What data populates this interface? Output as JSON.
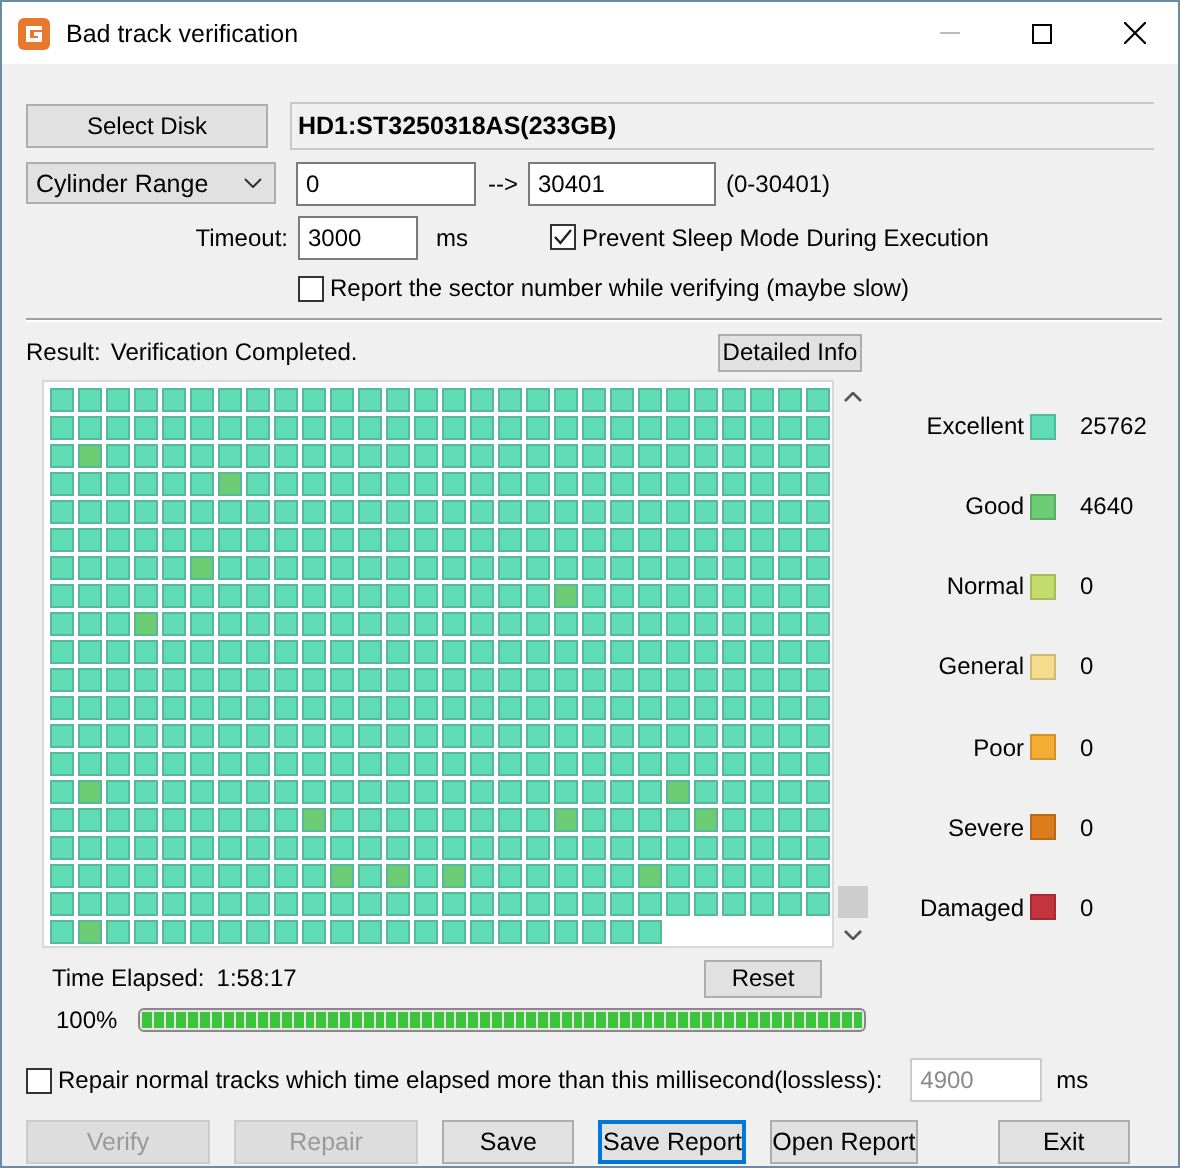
{
  "window": {
    "title": "Bad track verification"
  },
  "select_disk_button": "Select Disk",
  "disk_name": "HD1:ST3250318AS(233GB)",
  "range_mode": "Cylinder Range",
  "range_start": "0",
  "range_arrow": "-->",
  "range_end": "30401",
  "range_hint": "(0-30401)",
  "timeout": {
    "label": "Timeout:",
    "value": "3000",
    "unit": "ms"
  },
  "prevent_sleep": {
    "label": "Prevent Sleep Mode During Execution",
    "checked": true
  },
  "report_sector": {
    "label": "Report the sector number while verifying (maybe slow)",
    "checked": false
  },
  "result": {
    "label": "Result:",
    "value": "Verification Completed."
  },
  "detailed_info_button": "Detailed Info",
  "grid": {
    "good_cells": [
      [
        false,
        false,
        false,
        false,
        false,
        false,
        false,
        false,
        false,
        false,
        false,
        false,
        false,
        false,
        false,
        false,
        false,
        false,
        false,
        false,
        false,
        false,
        false,
        false,
        false,
        false,
        false,
        false
      ],
      [
        false,
        false,
        false,
        false,
        false,
        false,
        false,
        false,
        false,
        false,
        false,
        false,
        false,
        false,
        false,
        false,
        false,
        false,
        false,
        false,
        false,
        false,
        false,
        false,
        false,
        false,
        false,
        false
      ],
      [
        false,
        true,
        false,
        false,
        false,
        false,
        false,
        false,
        false,
        false,
        false,
        false,
        false,
        false,
        false,
        false,
        false,
        false,
        false,
        false,
        false,
        false,
        false,
        false,
        false,
        false,
        false,
        false
      ],
      [
        false,
        false,
        false,
        false,
        false,
        false,
        true,
        false,
        false,
        false,
        false,
        false,
        false,
        false,
        false,
        false,
        false,
        false,
        false,
        false,
        false,
        false,
        false,
        false,
        false,
        false,
        false,
        false
      ],
      [
        false,
        false,
        false,
        false,
        false,
        false,
        false,
        false,
        false,
        false,
        false,
        false,
        false,
        false,
        false,
        false,
        false,
        false,
        false,
        false,
        false,
        false,
        false,
        false,
        false,
        false,
        false,
        false
      ],
      [
        false,
        false,
        false,
        false,
        false,
        false,
        false,
        false,
        false,
        false,
        false,
        false,
        false,
        false,
        false,
        false,
        false,
        false,
        false,
        false,
        false,
        false,
        false,
        false,
        false,
        false,
        false,
        false
      ],
      [
        false,
        false,
        false,
        false,
        false,
        true,
        false,
        false,
        false,
        false,
        false,
        false,
        false,
        false,
        false,
        false,
        false,
        false,
        false,
        false,
        false,
        false,
        false,
        false,
        false,
        false,
        false,
        false
      ],
      [
        false,
        false,
        false,
        false,
        false,
        false,
        false,
        false,
        false,
        false,
        false,
        false,
        false,
        false,
        false,
        false,
        false,
        false,
        true,
        false,
        false,
        false,
        false,
        false,
        false,
        false,
        false,
        false
      ],
      [
        false,
        false,
        false,
        true,
        false,
        false,
        false,
        false,
        false,
        false,
        false,
        false,
        false,
        false,
        false,
        false,
        false,
        false,
        false,
        false,
        false,
        false,
        false,
        false,
        false,
        false,
        false,
        false
      ],
      [
        false,
        false,
        false,
        false,
        false,
        false,
        false,
        false,
        false,
        false,
        false,
        false,
        false,
        false,
        false,
        false,
        false,
        false,
        false,
        false,
        false,
        false,
        false,
        false,
        false,
        false,
        false,
        false
      ],
      [
        false,
        false,
        false,
        false,
        false,
        false,
        false,
        false,
        false,
        false,
        false,
        false,
        false,
        false,
        false,
        false,
        false,
        false,
        false,
        false,
        false,
        false,
        false,
        false,
        false,
        false,
        false,
        false
      ],
      [
        false,
        false,
        false,
        false,
        false,
        false,
        false,
        false,
        false,
        false,
        false,
        false,
        false,
        false,
        false,
        false,
        false,
        false,
        false,
        false,
        false,
        false,
        false,
        false,
        false,
        false,
        false,
        false
      ],
      [
        false,
        false,
        false,
        false,
        false,
        false,
        false,
        false,
        false,
        false,
        false,
        false,
        false,
        false,
        false,
        false,
        false,
        false,
        false,
        false,
        false,
        false,
        false,
        false,
        false,
        false,
        false,
        false
      ],
      [
        false,
        false,
        false,
        false,
        false,
        false,
        false,
        false,
        false,
        false,
        false,
        false,
        false,
        false,
        false,
        false,
        false,
        false,
        false,
        false,
        false,
        false,
        false,
        false,
        false,
        false,
        false,
        false
      ],
      [
        false,
        true,
        false,
        false,
        false,
        false,
        false,
        false,
        false,
        false,
        false,
        false,
        false,
        false,
        false,
        false,
        false,
        false,
        false,
        false,
        false,
        false,
        true,
        false,
        false,
        false,
        false,
        false
      ],
      [
        false,
        false,
        false,
        false,
        false,
        false,
        false,
        false,
        false,
        true,
        false,
        false,
        false,
        false,
        false,
        false,
        false,
        false,
        true,
        false,
        false,
        false,
        false,
        true,
        false,
        false,
        false,
        false
      ],
      [
        false,
        false,
        false,
        false,
        false,
        false,
        false,
        false,
        false,
        false,
        false,
        false,
        false,
        false,
        false,
        false,
        false,
        false,
        false,
        false,
        false,
        false,
        false,
        false,
        false,
        false,
        false,
        false
      ],
      [
        false,
        false,
        false,
        false,
        false,
        false,
        false,
        false,
        false,
        false,
        true,
        false,
        true,
        false,
        true,
        false,
        false,
        false,
        false,
        false,
        false,
        true,
        false,
        false,
        false,
        false,
        false,
        false
      ],
      [
        false,
        false,
        false,
        false,
        false,
        false,
        false,
        false,
        false,
        false,
        false,
        false,
        false,
        false,
        false,
        false,
        false,
        false,
        false,
        false,
        false,
        false,
        false,
        false,
        false,
        false,
        false,
        false
      ],
      [
        false,
        true,
        false,
        false,
        false,
        false,
        false,
        false,
        false,
        false,
        false,
        false,
        false,
        false,
        false,
        false,
        false,
        false,
        false,
        false,
        false,
        false
      ]
    ]
  },
  "legend": [
    {
      "label": "Excellent",
      "color": "#5fdcb4",
      "count": "25762"
    },
    {
      "label": "Good",
      "color": "#6ccc74",
      "count": "4640"
    },
    {
      "label": "Normal",
      "color": "#c4dc6c",
      "count": "0"
    },
    {
      "label": "General",
      "color": "#f4dc8c",
      "count": "0"
    },
    {
      "label": "Poor",
      "color": "#f4ac34",
      "count": "0"
    },
    {
      "label": "Severe",
      "color": "#dc7c1c",
      "count": "0"
    },
    {
      "label": "Damaged",
      "color": "#c4343c",
      "count": "0"
    }
  ],
  "time_elapsed": {
    "label": "Time Elapsed:",
    "value": "1:58:17"
  },
  "reset_button": "Reset",
  "progress": {
    "percent": "100%",
    "level": 1
  },
  "repair_option": {
    "label": "Repair normal tracks which time elapsed more than this millisecond(lossless):",
    "checked": false,
    "value": "4900",
    "disabled": true,
    "unit": "ms"
  },
  "buttons": [
    {
      "label": "Verify",
      "disabled": true,
      "default": false
    },
    {
      "label": "Repair",
      "disabled": true,
      "default": false
    },
    {
      "label": "Save",
      "disabled": false,
      "default": false
    },
    {
      "label": "Save Report",
      "disabled": false,
      "default": true
    },
    {
      "label": "Open Report",
      "disabled": false,
      "default": false
    },
    {
      "label": "Exit",
      "disabled": false,
      "default": false
    }
  ]
}
